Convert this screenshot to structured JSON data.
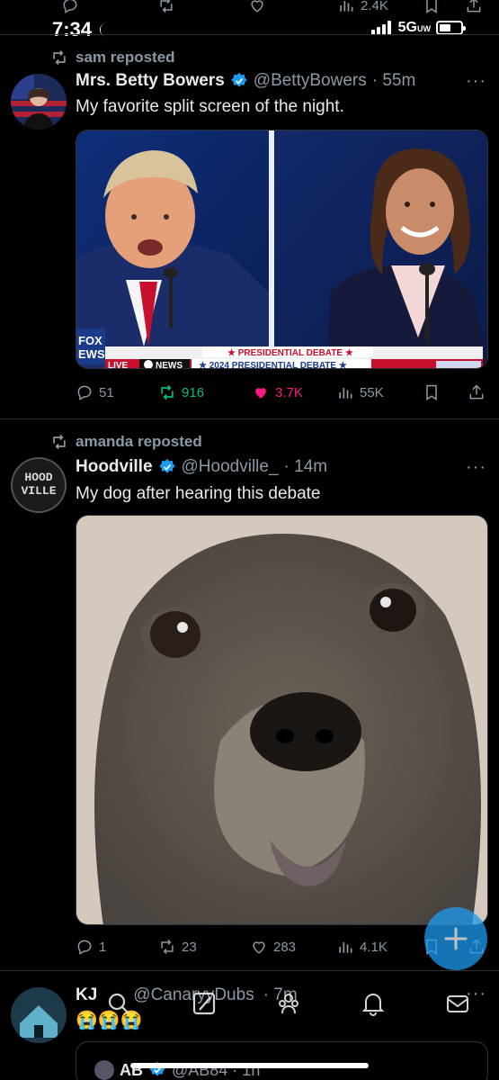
{
  "top_partial": {
    "views": "2.4K"
  },
  "status_bar": {
    "time": "7:34",
    "network": "5G",
    "network_sub": "UW"
  },
  "tweets": [
    {
      "repost_by": "sam reposted",
      "display_name": "Mrs. Betty Bowers",
      "handle": "@BettyBowers",
      "time": "· 55m",
      "text": "My favorite split screen of the night.",
      "media_caption": {
        "network": "FOX NEWS",
        "live": "LIVE",
        "abc": "NEWS",
        "banner_top": "PRESIDENTIAL DEBATE",
        "banner_bottom": "2024 PRESIDENTIAL DEBATE"
      },
      "replies": "51",
      "reposts": "916",
      "likes": "3.7K",
      "views": "55K"
    },
    {
      "repost_by": "amanda reposted",
      "display_name": "Hoodville",
      "handle": "@Hoodville_",
      "time": "· 14m",
      "text": "My dog after hearing this debate",
      "avatar_text": "HOOD VILLE",
      "replies": "1",
      "reposts": "23",
      "likes": "283",
      "views": "4.1K"
    },
    {
      "display_name": "KJ",
      "handle": "@CanaryyDubs",
      "time": "· 7m",
      "emoji": "😭😭😭"
    }
  ],
  "quoted": {
    "display_name": "AB",
    "handle": "@AB84 · 1h"
  },
  "more_label": "···",
  "colors": {
    "accent": "#1d9bf0",
    "like": "#f91880",
    "repost": "#00ba7c",
    "muted": "#8b98a5",
    "divider": "#2f3336"
  }
}
